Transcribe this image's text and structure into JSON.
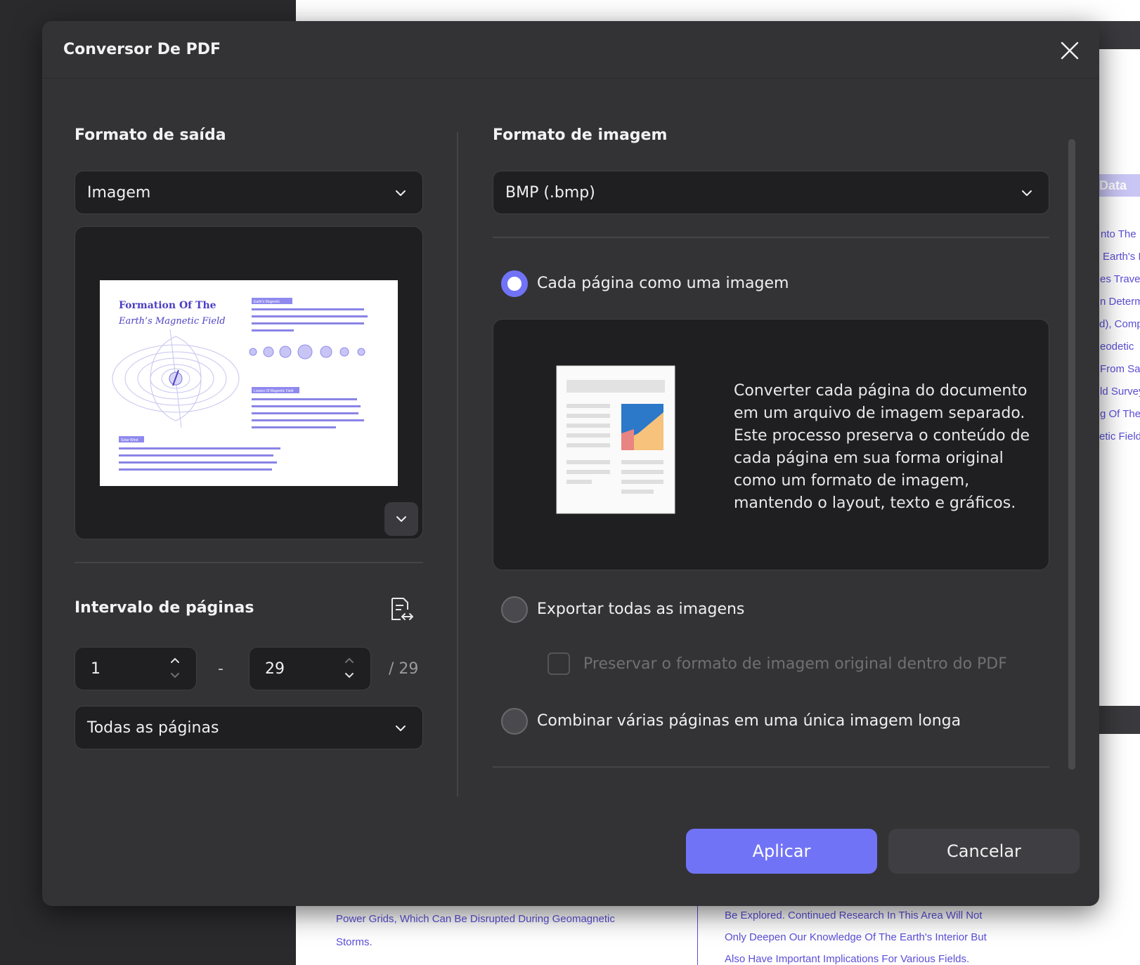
{
  "dialog": {
    "title": "Conversor De PDF",
    "close_icon": "close-icon"
  },
  "output": {
    "section_title": "Formato de saída",
    "format_value": "Imagem",
    "preview": {
      "title_line1": "Formation Of The",
      "title_line2": "Earth’s Magnetic Field",
      "tag1": "Earth's Magnetic",
      "tag2": "Losses Of Magnetic Field",
      "tag3": "Solar Wind"
    }
  },
  "range": {
    "section_title": "Intervalo de páginas",
    "from": "1",
    "separator": "-",
    "to": "29",
    "total": "/ 29",
    "pages_value": "Todas as páginas"
  },
  "image_format": {
    "section_title": "Formato de imagem",
    "value": "BMP (.bmp)"
  },
  "options": {
    "each_page": "Cada página como uma imagem",
    "each_page_desc": "Converter cada página do documento em um arquivo de imagem separado. Este processo preserva o conteúdo de cada página em sua forma original como um formato de imagem, mantendo o layout, texto e gráficos.",
    "export_all": "Exportar todas as imagens",
    "preserve_format": "Preservar o formato de imagem original dentro do PDF",
    "combine": "Combinar várias páginas em uma única imagem longa",
    "selected": "each_page"
  },
  "buttons": {
    "apply": "Aplicar",
    "cancel": "Cancelar"
  },
  "background": {
    "tag": "Data",
    "right_lines": [
      "nto The",
      "Earth's I",
      "es Trave",
      "n Determ",
      "d), Comp",
      "eodetic",
      "From Sa",
      "ld Survey",
      "g Of The",
      "etic Field"
    ],
    "bottom_left": [
      "Power Grids, Which Can Be Disrupted During Geomagnetic",
      "Storms."
    ],
    "bottom_right": [
      "Be Explored. Continued Research In This Area Will Not",
      "Only Deepen Our Knowledge Of The Earth's Interior But",
      "Also Have Important Implications For Various Fields."
    ]
  },
  "colors": {
    "accent": "#7173f7",
    "dialog_bg": "#333336",
    "field_bg": "#1f1f22",
    "link_text": "#5a4fd8"
  }
}
